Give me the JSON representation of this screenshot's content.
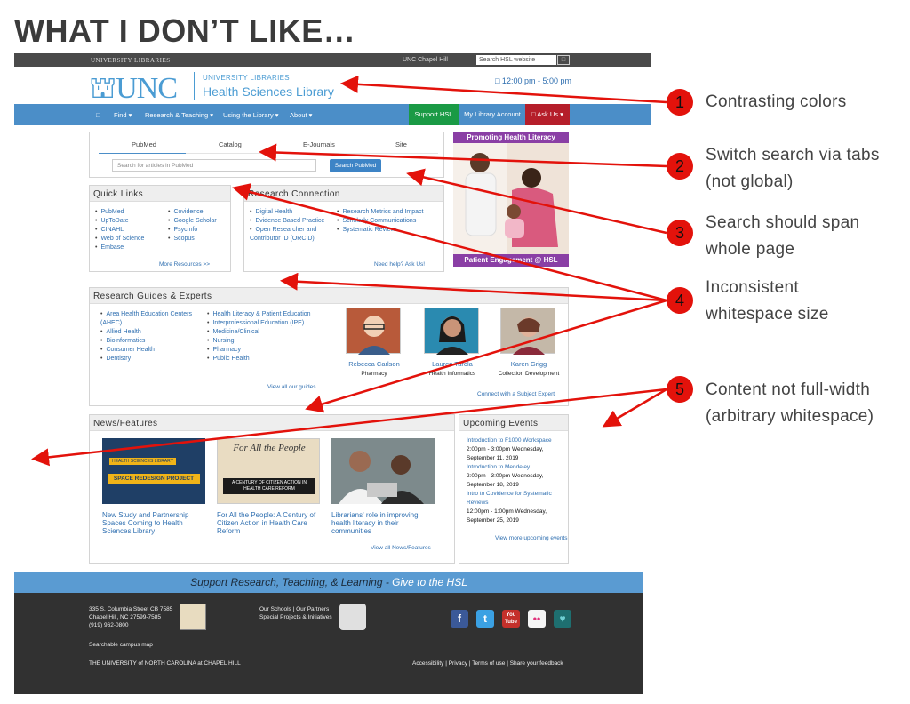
{
  "slide": {
    "title": "WHAT I DON’T LIKE…"
  },
  "topbar": {
    "brand": "UNIVERSITY LIBRARIES",
    "unc": "UNC Chapel Hill",
    "search_placeholder": "Search HSL website",
    "search_icon": "□"
  },
  "header": {
    "logo": "UNC",
    "ul": "UNIVERSITY LIBRARIES",
    "hsl": "Health Sciences Library",
    "hours": "□ 12:00 pm - 5:00 pm"
  },
  "nav": {
    "home": "□",
    "items": [
      "Find ▾",
      "Research & Teaching ▾",
      "Using the Library ▾",
      "About ▾"
    ],
    "support": "Support HSL",
    "account": "My Library Account",
    "askus": "□ Ask Us ▾"
  },
  "search": {
    "tabs": [
      "PubMed",
      "Catalog",
      "E-Journals",
      "Site"
    ],
    "placeholder": "Search for articles in PubMed",
    "button": "Search PubMed"
  },
  "promo": {
    "top": "Promoting Health Literacy",
    "bottom": "Patient Engagement @ HSL"
  },
  "quick_links": {
    "title": "Quick Links",
    "col1": [
      "PubMed",
      "UpToDate",
      "CINAHL",
      "Web of Science",
      "Embase"
    ],
    "col2": [
      "Covidence",
      "Google Scholar",
      "PsycInfo",
      "Scopus"
    ],
    "more": "More Resources >>"
  },
  "research_connection": {
    "title": "Research Connection",
    "col1": [
      "Digital Health",
      "Evidence Based Practice",
      "Open Researcher and Contributor ID (ORCID)"
    ],
    "col2": [
      "Research Metrics and Impact",
      "Scholarly Communications",
      "Systematic Reviews"
    ],
    "help": "Need help? Ask Us!"
  },
  "guides": {
    "title": "Research Guides & Experts",
    "col1": [
      "Area Health Education Centers (AHEC)",
      "Allied Health",
      "Bioinformatics",
      "Consumer Health",
      "Dentistry"
    ],
    "col2": [
      "Health Literacy & Patient Education",
      "Interprofessional Education (IPE)",
      "Medicine/Clinical",
      "Nursing",
      "Pharmacy",
      "Public Health"
    ],
    "view_all": "View all our guides",
    "people": [
      {
        "name": "Rebecca Carlson",
        "role": "Pharmacy"
      },
      {
        "name": "Lauren Tarola",
        "role": "Health Informatics"
      },
      {
        "name": "Karen Grigg",
        "role": "Collection Development"
      }
    ],
    "connect": "Connect with a Subject Expert"
  },
  "news": {
    "title": "News/Features",
    "items": [
      {
        "title": "New Study and Partnership Spaces Coming to Health Sciences Library",
        "img_label_1": "HEALTH SCIENCES LIBRARY",
        "img_label_2": "SPACE REDESIGN PROJECT"
      },
      {
        "title": "For All the People: A Century of Citizen Action in Health Care Reform",
        "img_label_1": "For All the People",
        "img_label_2": "A CENTURY OF CITIZEN ACTION IN HEALTH CARE REFORM"
      },
      {
        "title": "Librarians' role in improving health literacy in their communities"
      }
    ],
    "view_all": "View all News/Features"
  },
  "events": {
    "title": "Upcoming Events",
    "items": [
      {
        "title": "Introduction to F1000 Workspace",
        "date": "2:00pm - 3:00pm Wednesday, September 11, 2019"
      },
      {
        "title": "Introduction to Mendeley",
        "date": "2:00pm - 3:00pm Wednesday, September 18, 2019"
      },
      {
        "title": "Intro to Covidence for Systematic Reviews",
        "date": "12:00pm - 1:00pm Wednesday, September 25, 2019"
      }
    ],
    "more": "View more upcoming events"
  },
  "support_bar": {
    "text": "Support Research, Teaching, & Learning - ",
    "give": "Give to the HSL"
  },
  "footer": {
    "address": [
      "335 S. Columbia Street CB 7585",
      "Chapel Hill, NC 27599-7585",
      "(919) 962-0800"
    ],
    "map": "Searchable campus map",
    "links1": "Our Schools | Our Partners",
    "links2": "Special Projects & Initiatives",
    "university": "THE UNIVERSITY of NORTH CAROLINA at CHAPEL HILL",
    "bottom_links": "Accessibility  |  Privacy  |  Terms of use  |  Share your feedback",
    "social": [
      "f",
      "t",
      "You Tube",
      "••",
      "♥"
    ]
  },
  "annotations": [
    {
      "num": "1",
      "text": "Contrasting colors"
    },
    {
      "num": "2",
      "text": "Switch search via tabs (not global)"
    },
    {
      "num": "3",
      "text": "Search should span whole page"
    },
    {
      "num": "4",
      "text": "Inconsistent whitespace size"
    },
    {
      "num": "5",
      "text": "Content not full-width (arbitrary whitespace)"
    }
  ],
  "colors": {
    "nav_blue": "#4b8ec8",
    "unc_blue": "#4b9cd3",
    "support_green": "#1a9a45",
    "askus_red": "#b51e2a",
    "promo_purple": "#8a3fa5",
    "annotation_red": "#e3120b"
  }
}
